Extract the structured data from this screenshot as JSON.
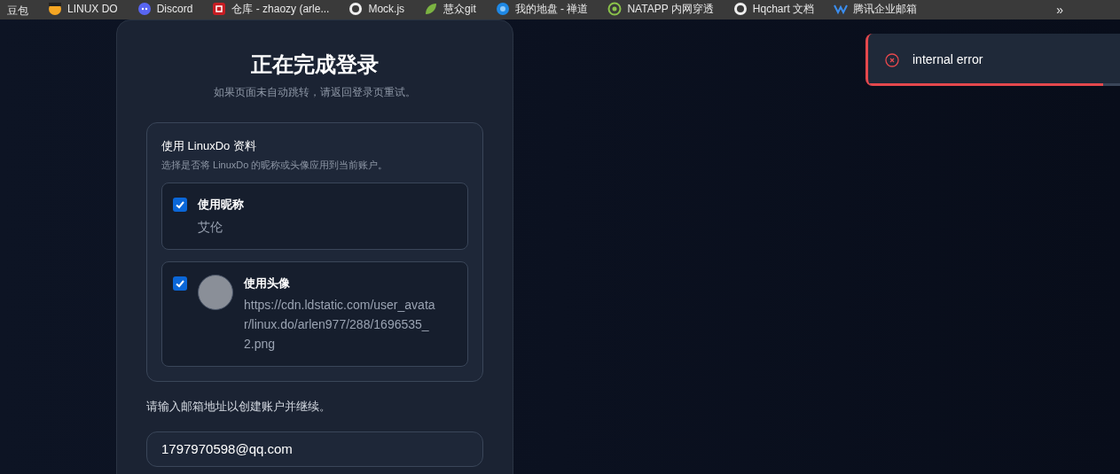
{
  "bookmarks": [
    {
      "label": "豆包",
      "kind": "plain"
    },
    {
      "label": "LINUX DO",
      "kind": "circle"
    },
    {
      "label": "Discord",
      "kind": "discord"
    },
    {
      "label": "仓库 - zhaozy (arle...",
      "kind": "gitee"
    },
    {
      "label": "Mock.js",
      "kind": "github"
    },
    {
      "label": "慧众git",
      "kind": "leaf"
    },
    {
      "label": "我的地盘 - 禅道",
      "kind": "swirl"
    },
    {
      "label": "NATAPP 内网穿透",
      "kind": "ring"
    },
    {
      "label": "Hqchart 文档",
      "kind": "github"
    },
    {
      "label": "腾讯企业邮箱",
      "kind": "mail"
    }
  ],
  "bookmarks_more": "»",
  "card": {
    "title": "正在完成登录",
    "subtitle": "如果页面未自动跳转，请返回登录页重试。",
    "profile": {
      "title": "使用 LinuxDo 资料",
      "description": "选择是否将 LinuxDo 的昵称或头像应用到当前账户。",
      "options": [
        {
          "kind": "text",
          "label": "使用昵称",
          "value": "艾伦",
          "checked": true
        },
        {
          "kind": "avatar",
          "label": "使用头像",
          "value": "https://cdn.ldstatic.com/user_avatar/linux.do/arlen977/288/1696535_2.png",
          "checked": true
        }
      ]
    },
    "email_prompt": "请输入邮箱地址以创建账户并继续。",
    "email": {
      "value": "1797970598@qq.com"
    }
  },
  "toast": {
    "message": "internal error",
    "level": 0.94
  }
}
